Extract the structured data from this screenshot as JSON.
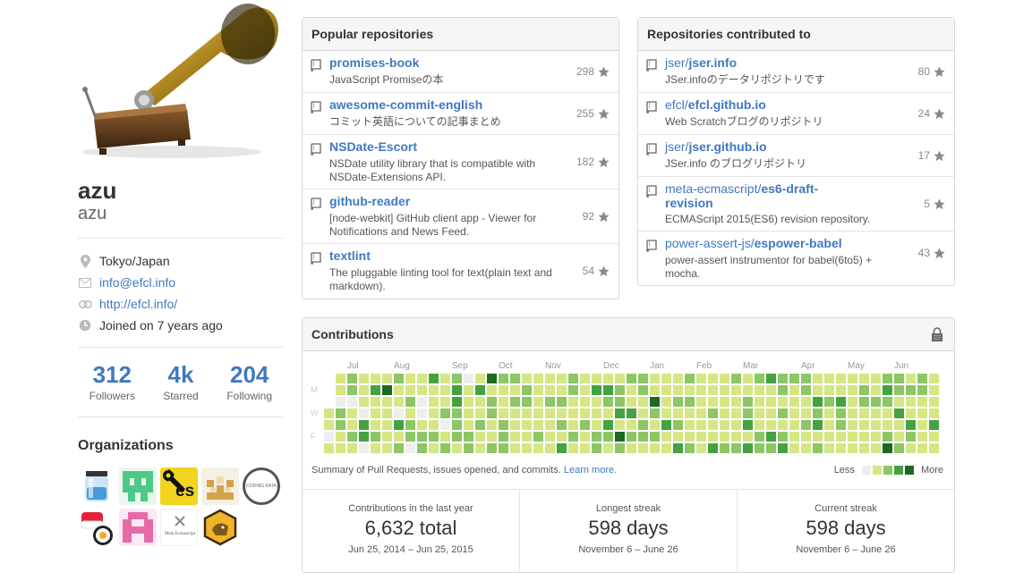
{
  "profile": {
    "name": "azu",
    "login": "azu",
    "location": "Tokyo/Japan",
    "email": "info@efcl.info",
    "url": "http://efcl.info/",
    "joined": "Joined on 7 years ago"
  },
  "stats": [
    {
      "num": "312",
      "label": "Followers"
    },
    {
      "num": "4k",
      "label": "Starred"
    },
    {
      "num": "204",
      "label": "Following"
    }
  ],
  "organizations": {
    "title": "Organizations",
    "items": [
      {
        "name": "jar-avatar"
      },
      {
        "name": "green-pixel-avatar"
      },
      {
        "name": "es-wrench-avatar",
        "text": "es"
      },
      {
        "name": "brown-pixel-avatar"
      },
      {
        "name": "coding-kata-avatar",
        "text": "CODING KATA"
      },
      {
        "name": "sushi-avatar"
      },
      {
        "name": "pink-pixel-avatar"
      },
      {
        "name": "meta-ecmascript-avatar",
        "text": "Meta Ecmascript"
      },
      {
        "name": "hex-animal-avatar"
      }
    ]
  },
  "popular": {
    "title": "Popular repositories",
    "repos": [
      {
        "name": "promises-book",
        "desc": "JavaScript Promiseの本",
        "stars": "298"
      },
      {
        "name": "awesome-commit-english",
        "desc": "コミット英語についての記事まとめ",
        "stars": "255"
      },
      {
        "name": "NSDate-Escort",
        "desc": "NSDate utility library that is compatible with NSDate-Extensions API.",
        "stars": "182"
      },
      {
        "name": "github-reader",
        "desc": "[node-webkit] GitHub client app - Viewer for Notifications and News Feed.",
        "stars": "92"
      },
      {
        "name": "textlint",
        "desc": "The pluggable linting tool for text(plain text and markdown).",
        "stars": "54"
      }
    ]
  },
  "contributed": {
    "title": "Repositories contributed to",
    "repos": [
      {
        "owner": "jser/",
        "name": "jser.info",
        "desc": "JSer.infoのデータリポジトリです",
        "stars": "80"
      },
      {
        "owner": "efcl/",
        "name": "efcl.github.io",
        "desc": "Web Scratchブログのリポジトリ",
        "stars": "24"
      },
      {
        "owner": "jser/",
        "name": "jser.github.io",
        "desc": "JSer.info のブログリポジトリ",
        "stars": "17"
      },
      {
        "owner": "meta-ecmascript/",
        "name": "es6-draft-revision",
        "desc": "ECMAScript 2015(ES6) revision repository.",
        "stars": "5"
      },
      {
        "owner": "power-assert-js/",
        "name": "espower-babel",
        "desc": "power-assert instrumentor for babel(6to5) + mocha.",
        "stars": "43"
      }
    ]
  },
  "contributions": {
    "title": "Contributions",
    "months": [
      "Jul",
      "Aug",
      "Sep",
      "Oct",
      "Nov",
      "Dec",
      "Jan",
      "Feb",
      "Mar",
      "Apr",
      "May",
      "Jun"
    ],
    "days": [
      "M",
      "W",
      "F"
    ],
    "summary": "Summary of Pull Requests, issues opened, and commits.",
    "learn_more": "Learn more.",
    "legend_less": "Less",
    "legend_more": "More",
    "colors": [
      "#eeeeee",
      "#d6e685",
      "#8cc665",
      "#44a340",
      "#1e6823"
    ],
    "streaks": [
      {
        "title": "Contributions in the last year",
        "value": "6,632 total",
        "range": "Jun 25, 2014 – Jun 25, 2015"
      },
      {
        "title": "Longest streak",
        "value": "598 days",
        "range": "November 6 – June 26"
      },
      {
        "title": "Current streak",
        "value": "598 days",
        "range": "November 6 – June 26"
      }
    ]
  }
}
